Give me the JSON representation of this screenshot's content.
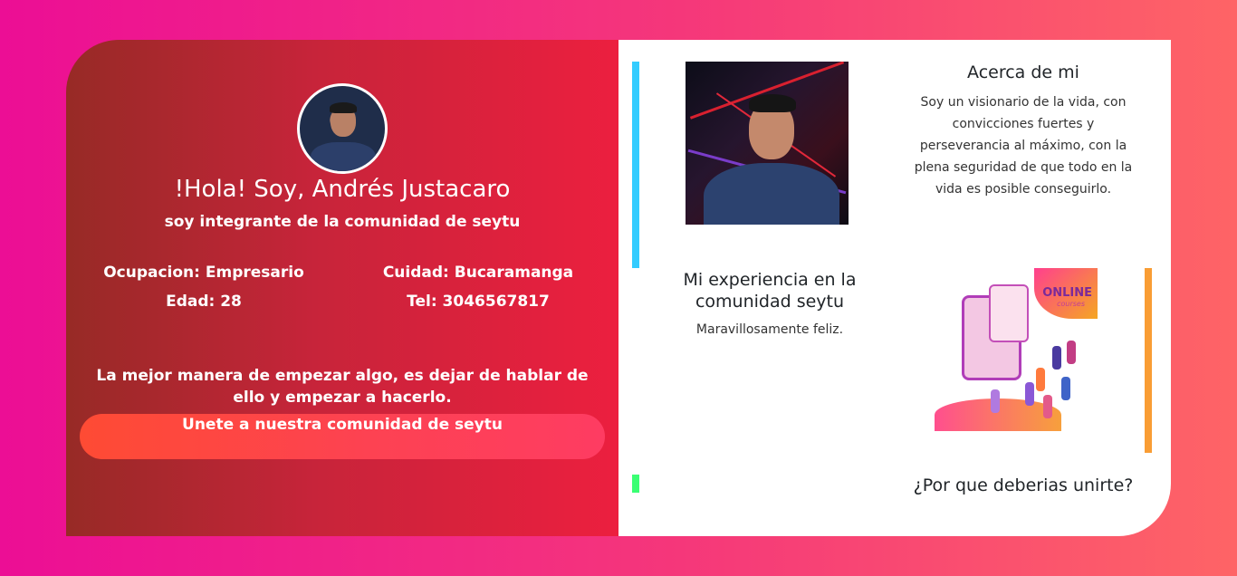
{
  "profile": {
    "greeting": "!Hola! Soy, Andrés Justacaro",
    "subtitle": "soy integrante de la comunidad de seytu",
    "occupation": "Ocupacion: Empresario",
    "city": "Cuidad: Bucaramanga",
    "age": "Edad: 28",
    "phone": "Tel: 3046567817",
    "quote": "La mejor manera de empezar algo, es dejar de hablar de ello y empezar a hacerlo.",
    "join_label": "Unete a nuestra comunidad de seytu"
  },
  "sections": {
    "about": {
      "title": "Acerca de mi",
      "text": "Soy un visionario de la vida, con convicciones fuertes y perseverancia al máximo, con la plena seguridad de que todo en la vida es posible conseguirlo."
    },
    "experience": {
      "title": "Mi experiencia en la comunidad seytu",
      "text": "Maravillosamente feliz."
    },
    "why": {
      "title": "¿Por que deberias unirte?"
    }
  },
  "illustration": {
    "title": "ONLINE",
    "subtitle": "courses"
  },
  "colors": {
    "bar_about": "#33ccff",
    "bar_experience": "#f99d34",
    "bar_why": "#3aff73",
    "accent": "#ec0e95"
  }
}
